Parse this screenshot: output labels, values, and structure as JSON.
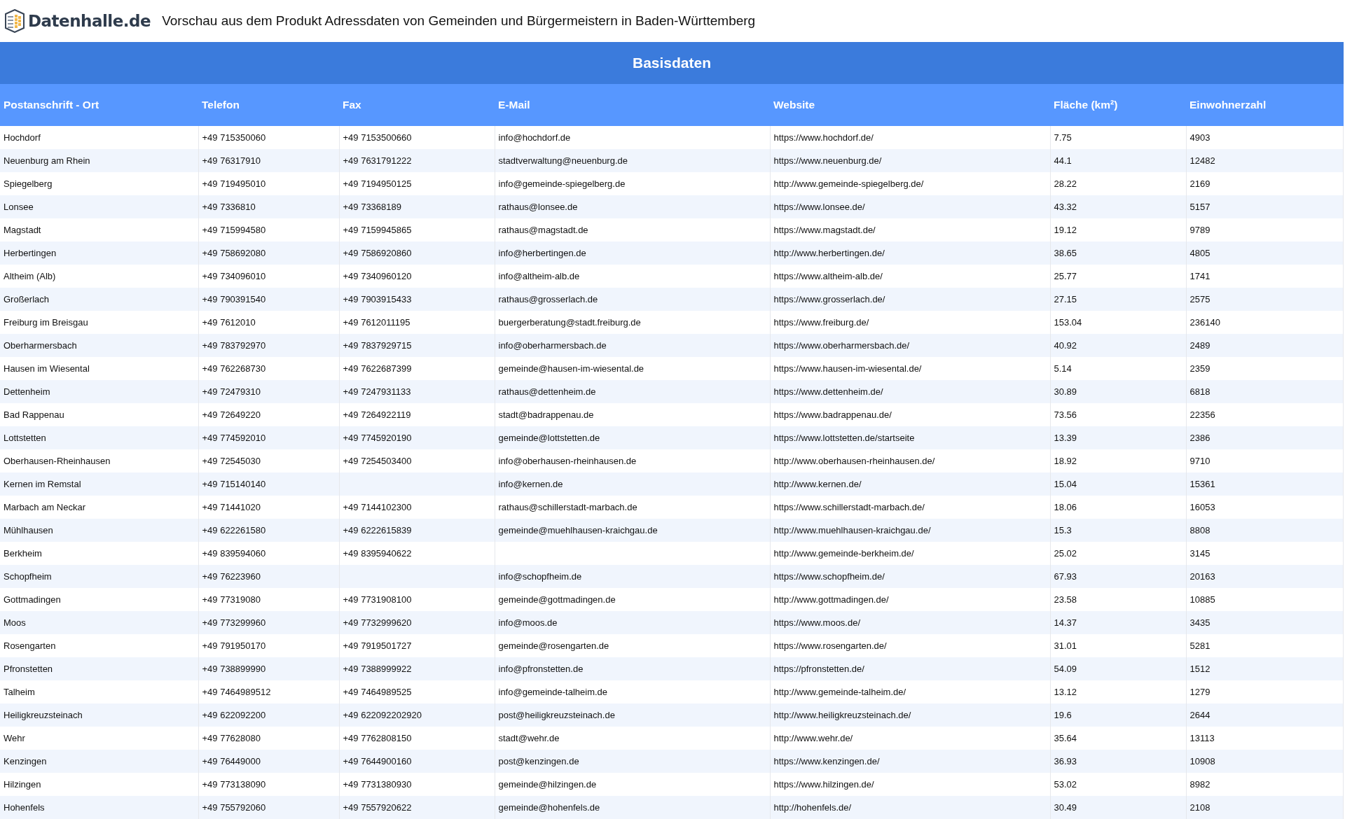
{
  "header": {
    "logo_text": "Datenhalle.de",
    "title": "Vorschau aus dem Produkt Adressdaten von Gemeinden und Bürgermeistern in Baden-Württemberg"
  },
  "table": {
    "section_title": "Basisdaten",
    "columns": [
      "Postanschrift - Ort",
      "Telefon",
      "Fax",
      "E-Mail",
      "Website",
      "Fläche (km²)",
      "Einwohnerzahl"
    ],
    "rows": [
      [
        "Hochdorf",
        "+49 715350060",
        "+49 7153500660",
        "info@hochdorf.de",
        "https://www.hochdorf.de/",
        "7.75",
        "4903"
      ],
      [
        "Neuenburg am Rhein",
        "+49 76317910",
        "+49 7631791222",
        "stadtverwaltung@neuenburg.de",
        "https://www.neuenburg.de/",
        "44.1",
        "12482"
      ],
      [
        "Spiegelberg",
        "+49 719495010",
        "+49 7194950125",
        "info@gemeinde-spiegelberg.de",
        "http://www.gemeinde-spiegelberg.de/",
        "28.22",
        "2169"
      ],
      [
        "Lonsee",
        "+49 7336810",
        "+49 73368189",
        "rathaus@lonsee.de",
        "https://www.lonsee.de/",
        "43.32",
        "5157"
      ],
      [
        "Magstadt",
        "+49 715994580",
        "+49 7159945865",
        "rathaus@magstadt.de",
        "https://www.magstadt.de/",
        "19.12",
        "9789"
      ],
      [
        "Herbertingen",
        "+49 758692080",
        "+49 7586920860",
        "info@herbertingen.de",
        "http://www.herbertingen.de/",
        "38.65",
        "4805"
      ],
      [
        "Altheim (Alb)",
        "+49 734096010",
        "+49 7340960120",
        "info@altheim-alb.de",
        "https://www.altheim-alb.de/",
        "25.77",
        "1741"
      ],
      [
        "Großerlach",
        "+49 790391540",
        "+49 7903915433",
        "rathaus@grosserlach.de",
        "https://www.grosserlach.de/",
        "27.15",
        "2575"
      ],
      [
        "Freiburg im Breisgau",
        "+49 7612010",
        "+49 7612011195",
        "buergerberatung@stadt.freiburg.de",
        "https://www.freiburg.de/",
        "153.04",
        "236140"
      ],
      [
        "Oberharmersbach",
        "+49 783792970",
        "+49 7837929715",
        "info@oberharmersbach.de",
        "https://www.oberharmersbach.de/",
        "40.92",
        "2489"
      ],
      [
        "Hausen im Wiesental",
        "+49 762268730",
        "+49 7622687399",
        "gemeinde@hausen-im-wiesental.de",
        "https://www.hausen-im-wiesental.de/",
        "5.14",
        "2359"
      ],
      [
        "Dettenheim",
        "+49 72479310",
        "+49 7247931133",
        "rathaus@dettenheim.de",
        "https://www.dettenheim.de/",
        "30.89",
        "6818"
      ],
      [
        "Bad Rappenau",
        "+49 72649220",
        "+49 7264922119",
        "stadt@badrappenau.de",
        "https://www.badrappenau.de/",
        "73.56",
        "22356"
      ],
      [
        "Lottstetten",
        "+49 774592010",
        "+49 7745920190",
        "gemeinde@lottstetten.de",
        "https://www.lottstetten.de/startseite",
        "13.39",
        "2386"
      ],
      [
        "Oberhausen-Rheinhausen",
        "+49 72545030",
        "+49 7254503400",
        "info@oberhausen-rheinhausen.de",
        "http://www.oberhausen-rheinhausen.de/",
        "18.92",
        "9710"
      ],
      [
        "Kernen im Remstal",
        "+49 715140140",
        null,
        "info@kernen.de",
        "http://www.kernen.de/",
        "15.04",
        "15361"
      ],
      [
        "Marbach am Neckar",
        "+49 71441020",
        "+49 7144102300",
        "rathaus@schillerstadt-marbach.de",
        "https://www.schillerstadt-marbach.de/",
        "18.06",
        "16053"
      ],
      [
        "Mühlhausen",
        "+49 622261580",
        "+49 6222615839",
        "gemeinde@muehlhausen-kraichgau.de",
        "http://www.muehlhausen-kraichgau.de/",
        "15.3",
        "8808"
      ],
      [
        "Berkheim",
        "+49 839594060",
        "+49 8395940622",
        null,
        "http://www.gemeinde-berkheim.de/",
        "25.02",
        "3145"
      ],
      [
        "Schopfheim",
        "+49 76223960",
        null,
        "info@schopfheim.de",
        "https://www.schopfheim.de/",
        "67.93",
        "20163"
      ],
      [
        "Gottmadingen",
        "+49 77319080",
        "+49 7731908100",
        "gemeinde@gottmadingen.de",
        "http://www.gottmadingen.de/",
        "23.58",
        "10885"
      ],
      [
        "Moos",
        "+49 773299960",
        "+49 7732999620",
        "info@moos.de",
        "https://www.moos.de/",
        "14.37",
        "3435"
      ],
      [
        "Rosengarten",
        "+49 791950170",
        "+49 7919501727",
        "gemeinde@rosengarten.de",
        "https://www.rosengarten.de/",
        "31.01",
        "5281"
      ],
      [
        "Pfronstetten",
        "+49 738899990",
        "+49 7388999922",
        "info@pfronstetten.de",
        "https://pfronstetten.de/",
        "54.09",
        "1512"
      ],
      [
        "Talheim",
        "+49 7464989512",
        "+49 7464989525",
        "info@gemeinde-talheim.de",
        "http://www.gemeinde-talheim.de/",
        "13.12",
        "1279"
      ],
      [
        "Heiligkreuzsteinach",
        "+49 622092200",
        "+49 622092202920",
        "post@heiligkreuzsteinach.de",
        "http://www.heiligkreuzsteinach.de/",
        "19.6",
        "2644"
      ],
      [
        "Wehr",
        "+49 77628080",
        "+49 7762808150",
        "stadt@wehr.de",
        "http://www.wehr.de/",
        "35.64",
        "13113"
      ],
      [
        "Kenzingen",
        "+49 76449000",
        "+49 7644900160",
        "post@kenzingen.de",
        "https://www.kenzingen.de/",
        "36.93",
        "10908"
      ],
      [
        "Hilzingen",
        "+49 773138090",
        "+49 7731380930",
        "gemeinde@hilzingen.de",
        "https://www.hilzingen.de/",
        "53.02",
        "8982"
      ],
      [
        "Hohenfels",
        "+49 755792060",
        "+49 7557920622",
        "gemeinde@hohenfels.de",
        "http://hohenfels.de/",
        "30.49",
        "2108"
      ]
    ]
  }
}
